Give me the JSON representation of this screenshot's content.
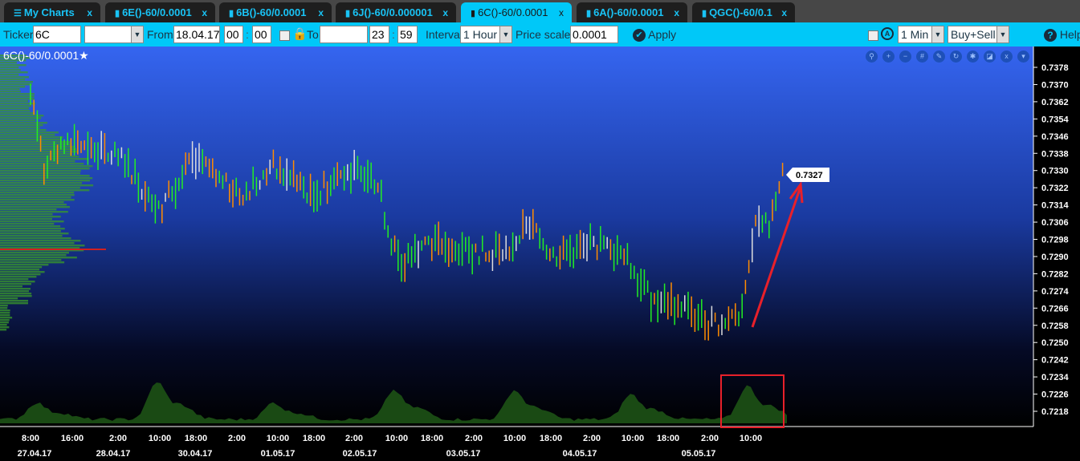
{
  "tabs": [
    {
      "label": "My Charts",
      "icon": "menu-icon"
    },
    {
      "label": "6E()-60/0.0001",
      "icon": "bar-chart-icon"
    },
    {
      "label": "6B()-60/0.0001",
      "icon": "bar-chart-icon"
    },
    {
      "label": "6J()-60/0.000001",
      "icon": "bar-chart-icon"
    },
    {
      "label": "6C()-60/0.0001",
      "icon": "bar-chart-icon",
      "active": true
    },
    {
      "label": "6A()-60/0.0001",
      "icon": "bar-chart-icon"
    },
    {
      "label": "QGC()-60/0.1",
      "icon": "bar-chart-icon"
    }
  ],
  "close_glyph": "x",
  "toolbar": {
    "ticker_label": "Ticker",
    "ticker_value": "6C",
    "contract_value": "",
    "from_label": "From",
    "from_date": "18.04.17",
    "from_hour": "00",
    "from_min": "00",
    "to_label": "To",
    "to_date": "",
    "to_hour": "23",
    "to_min": "59",
    "colon": ":",
    "interval_label": "Interval",
    "interval_value": "1 Hour",
    "price_scale_label": "Price scale",
    "price_scale_value": "0.0001",
    "apply_label": "Apply",
    "timeframe_value": "1 Min",
    "side_value": "Buy+Sell",
    "help_label": "Help"
  },
  "chart": {
    "title": "6C()-60/0.0001",
    "star": "★",
    "last_price": "0.7327",
    "y_ticks": [
      "0.7378",
      "0.7370",
      "0.7362",
      "0.7354",
      "0.7346",
      "0.7338",
      "0.7330",
      "0.7322",
      "0.7314",
      "0.7306",
      "0.7298",
      "0.7290",
      "0.7282",
      "0.7274",
      "0.7266",
      "0.7258",
      "0.7250",
      "0.7242",
      "0.7234",
      "0.7226",
      "0.7218"
    ],
    "time_labels": [
      "8:00",
      "16:00",
      "2:00",
      "10:00",
      "18:00",
      "2:00",
      "10:00",
      "18:00",
      "2:00",
      "10:00",
      "18:00",
      "2:00",
      "10:00",
      "18:00",
      "2:00",
      "10:00",
      "18:00",
      "2:00",
      "10:00"
    ],
    "date_labels": [
      "27.04.17",
      "28.04.17",
      "30.04.17",
      "01.05.17",
      "02.05.17",
      "03.05.17",
      "04.05.17",
      "05.05.17"
    ],
    "price_path": [
      0.7365,
      0.733,
      0.7345,
      0.7335,
      0.7312,
      0.7335,
      0.7318,
      0.7332,
      0.7318,
      0.733,
      0.7325,
      0.73,
      0.7285,
      0.7298,
      0.7292,
      0.7292,
      0.7305,
      0.729,
      0.7296,
      0.729,
      0.727,
      0.7268,
      0.7258,
      0.7262,
      0.729,
      0.7305,
      0.7305,
      0.733
    ],
    "colors": {
      "up": "#22ee22",
      "down": "#ff8c00",
      "flat": "#dddddd",
      "annotation": "#e8202a"
    }
  }
}
